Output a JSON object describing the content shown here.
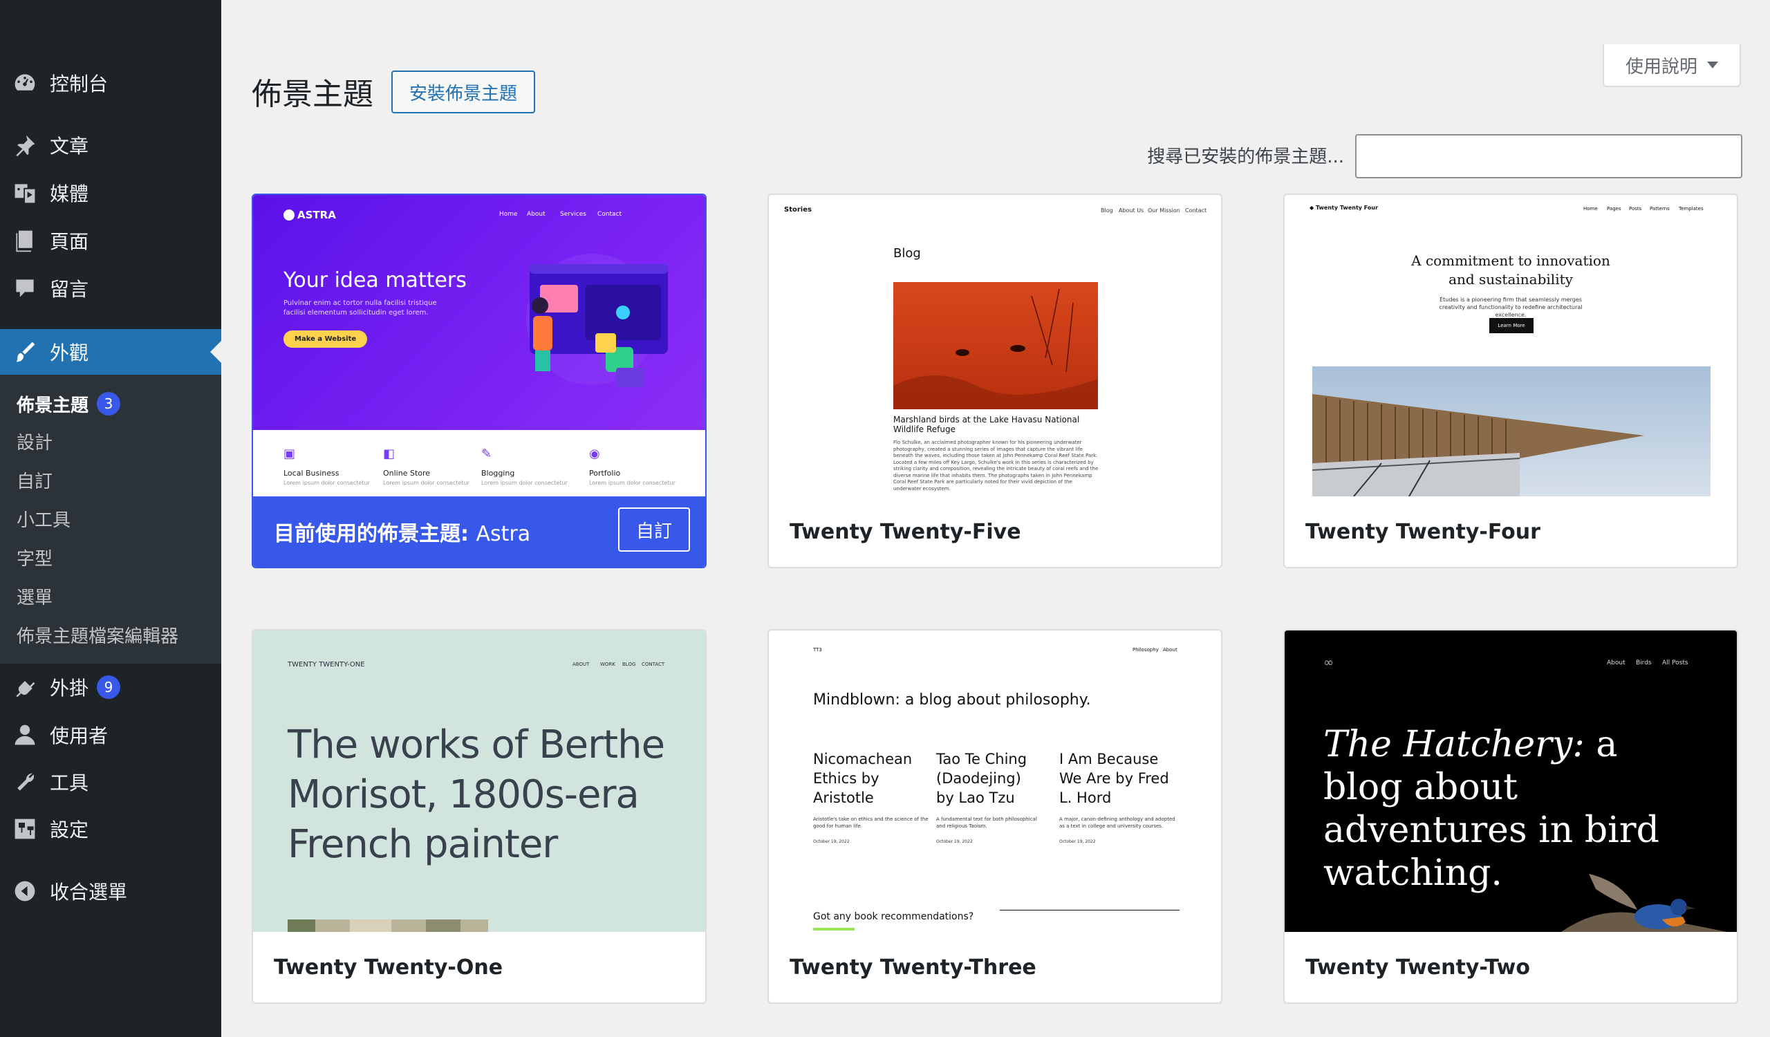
{
  "sidebar": {
    "menu": [
      {
        "label": "控制台",
        "icon": "dashboard-icon"
      },
      {
        "label": "文章",
        "icon": "pin-icon"
      },
      {
        "label": "媒體",
        "icon": "media-icon"
      },
      {
        "label": "頁面",
        "icon": "pages-icon"
      },
      {
        "label": "留言",
        "icon": "comment-icon"
      },
      {
        "label": "外觀",
        "icon": "brush-icon"
      },
      {
        "label": "外掛",
        "icon": "plugin-icon"
      },
      {
        "label": "使用者",
        "icon": "user-icon"
      },
      {
        "label": "工具",
        "icon": "wrench-icon"
      },
      {
        "label": "設定",
        "icon": "settings-icon"
      },
      {
        "label": "收合選單",
        "icon": "collapse-icon"
      }
    ],
    "plugins_badge": "9",
    "submenu": [
      {
        "label": "佈景主題",
        "badge": "3"
      },
      {
        "label": "設計"
      },
      {
        "label": "自訂"
      },
      {
        "label": "小工具"
      },
      {
        "label": "字型"
      },
      {
        "label": "選單"
      },
      {
        "label": "佈景主題檔案編輯器"
      }
    ]
  },
  "header": {
    "title": "佈景主題",
    "install_label": "安裝佈景主題",
    "help_label": "使用說明",
    "search_label": "搜尋已安裝的佈景主題..."
  },
  "themes": [
    {
      "name": "Astra",
      "active_prefix": "目前使用的佈景主題:",
      "customize_label": "自訂",
      "preview": {
        "logo": "ASTRA",
        "nav": [
          "Home",
          "About",
          "Services",
          "Contact"
        ],
        "headline": "Your idea matters",
        "body": "Pulvinar enim ac tortor nulla facilisi tristique facilisi elementum sollicitudin eget lorem.",
        "cta": "Make a Website",
        "features": [
          "Local Business",
          "Online Store",
          "Blogging",
          "Portfolio"
        ],
        "feature_text": "Lorem ipsum dolor consectetur"
      }
    },
    {
      "name": "Twenty Twenty-Five",
      "preview": {
        "site": "Stories",
        "nav": [
          "Blog",
          "About Us",
          "Our Mission",
          "Contact"
        ],
        "heading": "Blog",
        "post_title": "Marshland birds at the Lake Havasu National Wildlife Refuge",
        "post_body": "Flo Schulke, an acclaimed photographer known for his pioneering underwater photography, created a stunning series of images that capture the vibrant life beneath the waves, including those taken at John Pennekamp Coral Reef State Park. Located a few miles off Key Largo, Schulke's work in this series is characterized by striking clarity and composition, revealing the intricate beauty of coral reefs and the diverse marine life that inhabits them. The photographs taken in John Pennekamp Coral Reef State Park are particularly noted for their vivid depiction of the underwater ecosystem."
      }
    },
    {
      "name": "Twenty Twenty-Four",
      "preview": {
        "site": "Twenty Twenty Four",
        "nav": [
          "Home",
          "Pages",
          "Posts",
          "Patterns",
          "Templates"
        ],
        "headline": "A commitment to innovation and sustainability",
        "body": "Études is a pioneering firm that seamlessly merges creativity and functionality to redefine architectural excellence.",
        "cta": "Learn More"
      }
    },
    {
      "name": "Twenty Twenty-One",
      "preview": {
        "site": "TWENTY TWENTY-ONE",
        "nav": [
          "ABOUT",
          "WORK",
          "BLOG",
          "CONTACT"
        ],
        "headline": "The works of Berthe Morisot, 1800s-era French painter"
      }
    },
    {
      "name": "Twenty Twenty-Three",
      "preview": {
        "site": "TT3",
        "nav": [
          "Philosophy",
          "About"
        ],
        "headline": "Mindblown: a blog about philosophy.",
        "posts": [
          {
            "title": "Nicomachean Ethics by Aristotle",
            "text": "Aristotle's take on ethics and the science of the good for human life.",
            "date": "October 19, 2022"
          },
          {
            "title": "Tao Te Ching (Daodejing) by Lao Tzu",
            "text": "A fundamental text for both philosophical and religious Taoism.",
            "date": "October 19, 2022"
          },
          {
            "title": "I Am Because We Are by Fred L. Hord",
            "text": "A major, canon-defining anthology and adopted as a text in college and university courses.",
            "date": "October 19, 2022"
          }
        ],
        "footer_q": "Got any book recommendations?"
      }
    },
    {
      "name": "Twenty Twenty-Two",
      "preview": {
        "nav": [
          "About",
          "Birds",
          "All Posts"
        ],
        "headline_em": "The Hatchery:",
        "headline_rest": "a blog about adventures in bird watching."
      }
    }
  ],
  "colors": {
    "sidebar_bg": "#1d2327",
    "active_menu": "#2271b1",
    "active_theme": "#3858e9",
    "astra_purple": "#6b1ff0"
  }
}
